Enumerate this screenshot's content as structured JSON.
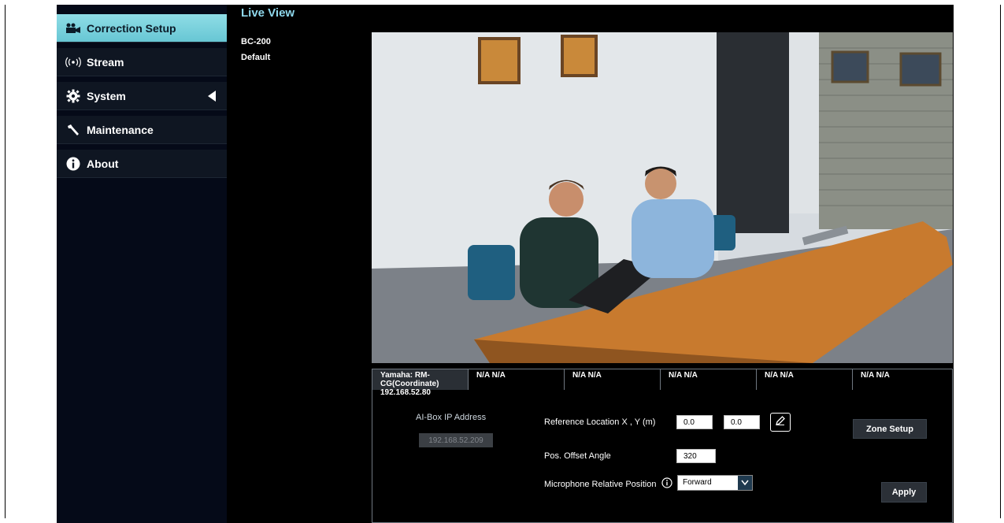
{
  "sidebar": {
    "items": [
      {
        "label": "Correction Setup",
        "icon": "video-camera-icon",
        "active": true
      },
      {
        "label": "Stream",
        "icon": "broadcast-icon",
        "active": false
      },
      {
        "label": "System",
        "icon": "gear-icon",
        "active": false
      },
      {
        "label": "Maintenance",
        "icon": "wrench-icon",
        "active": false
      },
      {
        "label": "About",
        "icon": "info-icon",
        "active": false
      }
    ]
  },
  "main": {
    "title": "Live View",
    "model": "BC-200",
    "preset": "Default"
  },
  "tabs": [
    {
      "label": "Yamaha: RM-CG(Coordinate) 192.168.52.80"
    },
    {
      "label": "N/A N/A"
    },
    {
      "label": "N/A N/A"
    },
    {
      "label": "N/A N/A"
    },
    {
      "label": "N/A N/A"
    },
    {
      "label": "N/A N/A"
    }
  ],
  "form": {
    "ai_box_label": "AI-Box IP Address",
    "ai_box_ip": "192.168.52.209",
    "ref_location_label": "Reference Location X , Y (m)",
    "ref_x": "0.0",
    "ref_y": "0.0",
    "offset_angle_label": "Pos. Offset Angle",
    "offset_angle": "320",
    "mic_position_label": "Microphone Relative Position",
    "mic_position_value": "Forward",
    "zone_setup_label": "Zone Setup",
    "apply_label": "Apply"
  },
  "colors": {
    "accent": "#67c6d4",
    "title": "#8fd8ec",
    "background": "#000000"
  }
}
